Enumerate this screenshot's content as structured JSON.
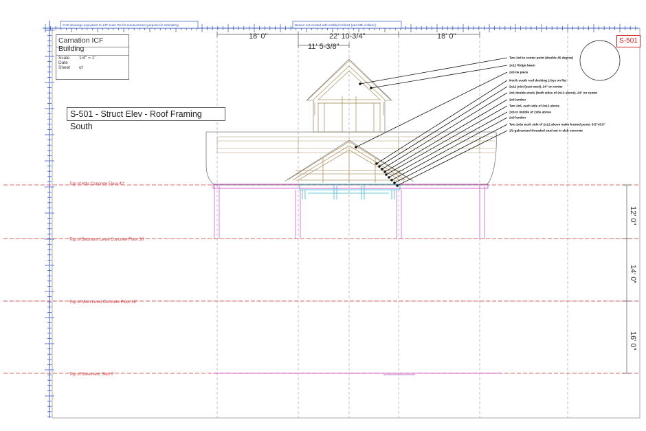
{
  "title_block": {
    "building": "Carnation ICF Building",
    "rows": [
      {
        "label": "Scale",
        "value": "1/4\" = 1'"
      },
      {
        "label": "Date",
        "value": ""
      },
      {
        "label": "Sheet",
        "value": "of"
      }
    ]
  },
  "view_title": "S-501 - Struct Elev - Roof Framing South",
  "sheet_id": "S-501",
  "ruler_notes": [
    "CAD drawings equivalent to 1/8\" scale OK for measurement purpose for estimating",
    "Beams not located with enabled refined (and 50k children)"
  ],
  "top_dimensions": [
    "18' 0\"",
    "22' 10-3/4\"",
    "18' 0\"",
    "11' 5-3/8\""
  ],
  "level_labels": [
    "Top of Attic Concrete Floor  42'",
    "Top of Bedroom Level Concrete Floor  30'",
    "Top of Main Level Concrete Floor  16'",
    "Top of Basement Slab  0'"
  ],
  "right_dimensions": [
    "12' 0\"",
    "14' 0\"",
    "16' 0\""
  ],
  "annotations": [
    "Two 2x6 to center point (double 45 degree)",
    "2x12 Ridge beam",
    "2x6 tie piece",
    "North south roof decking 2-byx on flat",
    "2x12 joist (east west), 24\" on center",
    "2x6 double studs (both sides of 2x12 above), 24\" on center",
    "2x6 lumber",
    "Two 2x6, each side of 2x12 above",
    "2x6 in middle of 2x6s above",
    "2x6 lumber",
    "Two 2x6s each side of 2x12 above make framed posts: 8.5\"x5.5\"",
    "1/2 galvanized threaded stud set in slab concrete"
  ],
  "colors": {
    "grid": "#9a9a9a",
    "ruler": "#3a5cc0",
    "level": "#d23a3a",
    "framing": "#b0966a",
    "magenta": "#cc44cc",
    "cyan": "#3ab8c8",
    "dimension": "#555555",
    "badge": "#cc2222"
  }
}
